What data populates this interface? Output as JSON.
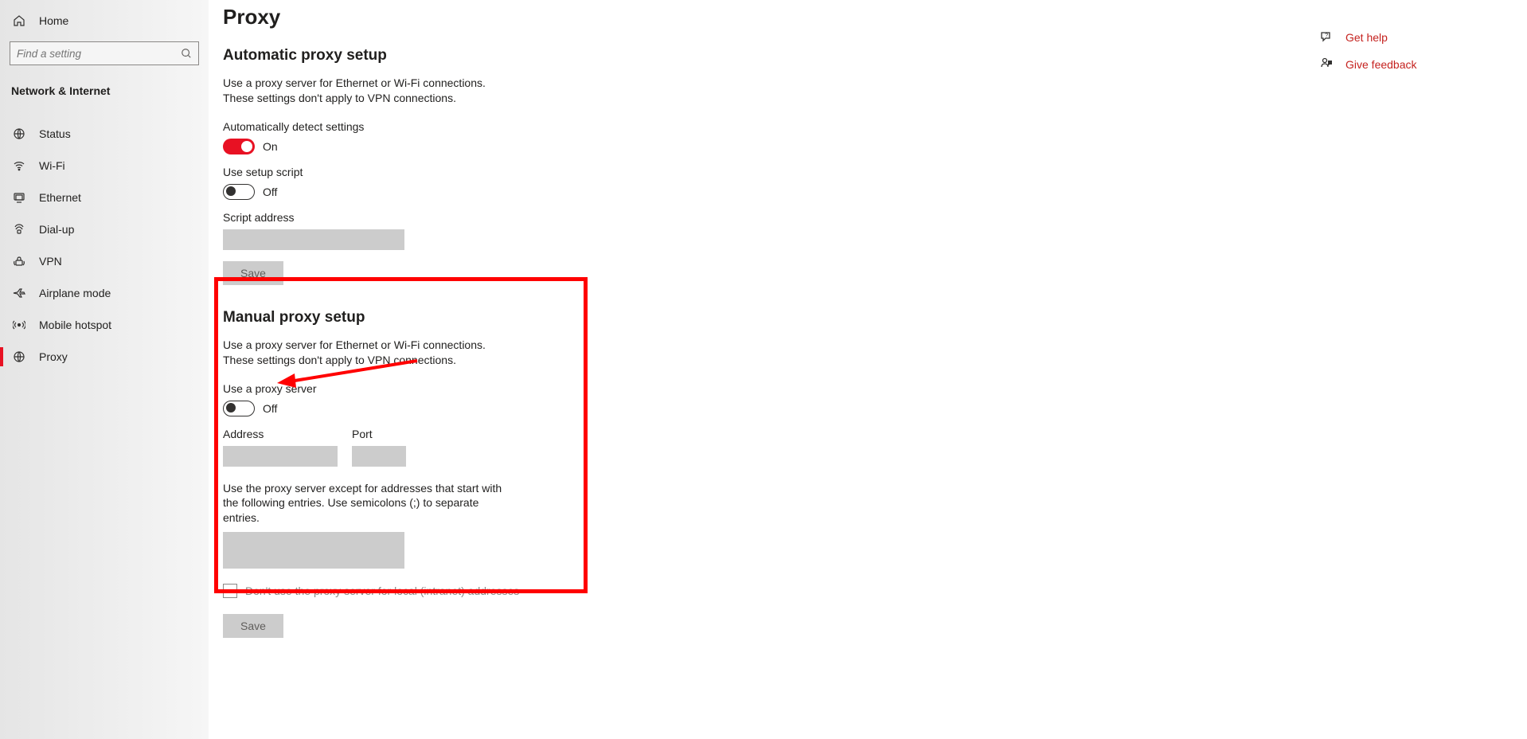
{
  "sidebar": {
    "home_label": "Home",
    "search_placeholder": "Find a setting",
    "section_label": "Network & Internet",
    "items": [
      {
        "label": "Status",
        "icon": "status-icon"
      },
      {
        "label": "Wi-Fi",
        "icon": "wifi-icon"
      },
      {
        "label": "Ethernet",
        "icon": "ethernet-icon"
      },
      {
        "label": "Dial-up",
        "icon": "dialup-icon"
      },
      {
        "label": "VPN",
        "icon": "vpn-icon"
      },
      {
        "label": "Airplane mode",
        "icon": "airplane-icon"
      },
      {
        "label": "Mobile hotspot",
        "icon": "hotspot-icon"
      },
      {
        "label": "Proxy",
        "icon": "proxy-icon",
        "selected": true
      }
    ]
  },
  "page": {
    "title": "Proxy"
  },
  "auto": {
    "title": "Automatic proxy setup",
    "desc": "Use a proxy server for Ethernet or Wi-Fi connections. These settings don't apply to VPN connections.",
    "detect_label": "Automatically detect settings",
    "detect_state": "On",
    "script_label": "Use setup script",
    "script_state": "Off",
    "addr_label": "Script address",
    "save_label": "Save"
  },
  "manual": {
    "title": "Manual proxy setup",
    "desc": "Use a proxy server for Ethernet or Wi-Fi connections. These settings don't apply to VPN connections.",
    "use_label": "Use a proxy server",
    "use_state": "Off",
    "addr_label": "Address",
    "port_label": "Port",
    "except_label": "Use the proxy server except for addresses that start with the following entries. Use semicolons (;) to separate entries.",
    "local_label": "Don't use the proxy server for local (intranet) addresses",
    "save_label": "Save"
  },
  "help": {
    "get_help": "Get help",
    "give_feedback": "Give feedback"
  }
}
